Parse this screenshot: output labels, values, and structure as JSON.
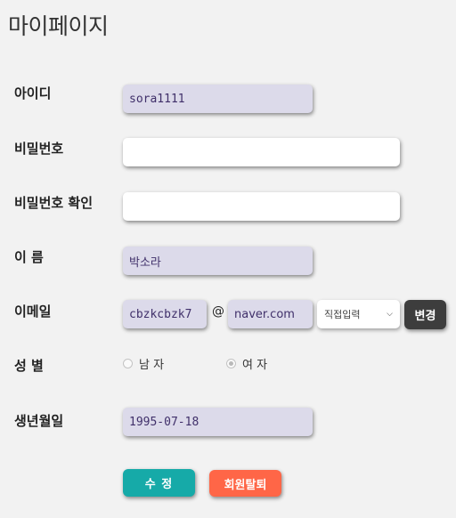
{
  "page": {
    "title": "마이페이지"
  },
  "form": {
    "id": {
      "label": "아이디",
      "value": "sora1111"
    },
    "password": {
      "label": "비밀번호",
      "value": ""
    },
    "password_confirm": {
      "label": "비밀번호 확인",
      "value": ""
    },
    "name": {
      "label": "이 름",
      "value": "박소라"
    },
    "email": {
      "label": "이메일",
      "local": "cbzkcbzk7",
      "at": "@",
      "domain": "naver.com",
      "domain_select": "직접입력",
      "change_button": "변경"
    },
    "gender": {
      "label": "성 별",
      "options": [
        "남 자",
        "여 자"
      ],
      "selected": "여 자"
    },
    "birth": {
      "label": "생년월일",
      "value": "1995-07-18"
    }
  },
  "actions": {
    "edit": "수 정",
    "withdraw": "회원탈퇴"
  },
  "colors": {
    "background": "#f2f2f2",
    "filled_field": "#dcdaea",
    "edit_button": "#16aaa8",
    "withdraw_button": "#ff6647",
    "change_button": "#3d3d3d"
  }
}
